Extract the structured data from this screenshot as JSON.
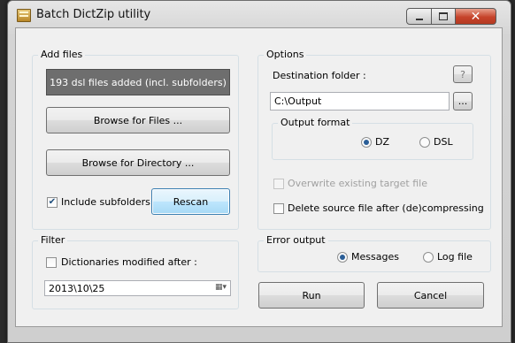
{
  "window": {
    "title": "Batch DictZip utility"
  },
  "add_files": {
    "title": "Add files",
    "status": "193 dsl files added (incl. subfolders)",
    "browse_files_label": "Browse for Files ...",
    "browse_directory_label": "Browse for Directory ...",
    "include_subfolders_label": "Include subfolders",
    "include_subfolders_checked": true,
    "rescan_label": "Rescan"
  },
  "filter": {
    "title": "Filter",
    "modified_after_label": "Dictionaries modified after :",
    "modified_after_checked": false,
    "date_value": "2013\\10\\25"
  },
  "options": {
    "title": "Options",
    "destination_label": "Destination folder :",
    "help_label": "?",
    "destination_value": "C:\\Output",
    "browse_label": "...",
    "output_format": {
      "title": "Output format",
      "options": [
        "DZ",
        "DSL"
      ],
      "selected": "DZ"
    },
    "overwrite_label": "Overwrite existing target file",
    "overwrite_enabled": false,
    "delete_source_label": "Delete source file after (de)compressing",
    "delete_source_checked": false
  },
  "error_output": {
    "title": "Error output",
    "options": [
      "Messages",
      "Log file"
    ],
    "selected": "Messages"
  },
  "actions": {
    "run_label": "Run",
    "cancel_label": "Cancel"
  },
  "icons": {
    "window_close": "close-icon",
    "window_max": "maximize-icon",
    "window_min": "minimize-icon",
    "calendar": "calendar-icon"
  }
}
